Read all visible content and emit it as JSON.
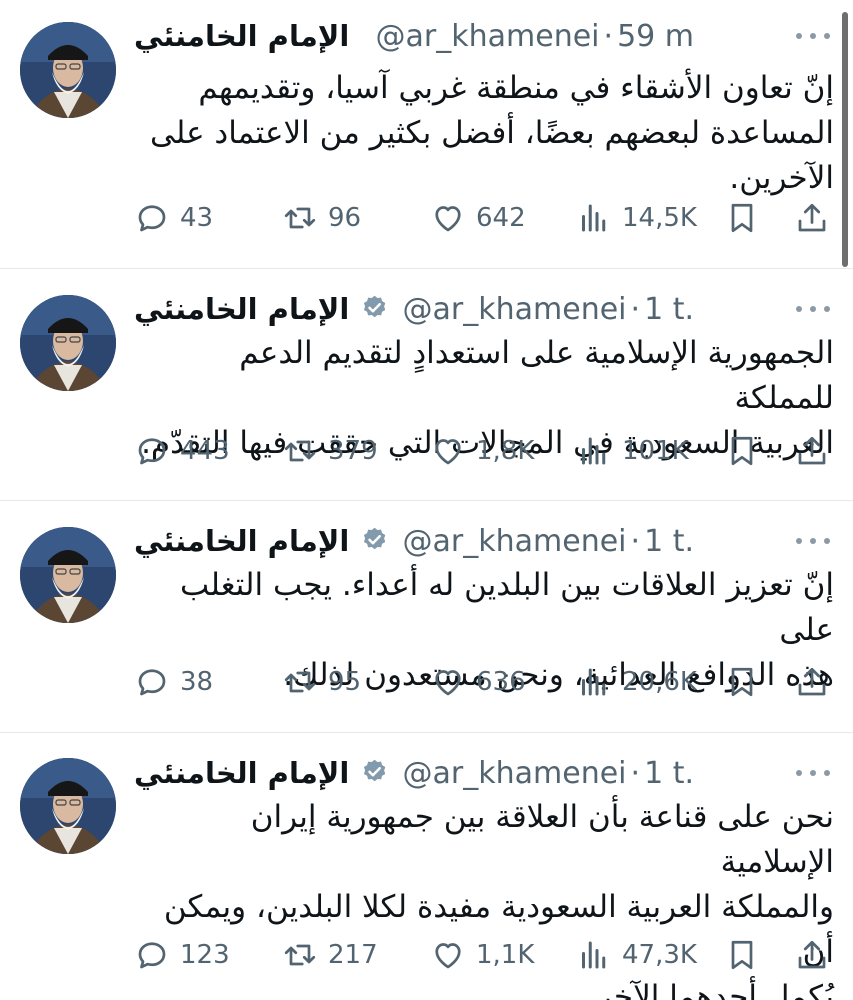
{
  "tweets": [
    {
      "name": "الإمام الخامنئي",
      "handle": "@ar_khamenei",
      "separator": "·",
      "time": "59 m",
      "lines": [
        "إنّ تعاون الأشقاء في منطقة غربي آسيا، وتقديمهم",
        "المساعدة لبعضهم بعضًا، أفضل بكثير من الاعتماد على",
        "الآخرين."
      ],
      "replies": "43",
      "reposts": "96",
      "likes": "642",
      "views": "14,5K"
    },
    {
      "name": "الإمام الخامنئي",
      "handle": "@ar_khamenei",
      "separator": "·",
      "time": "1 t.",
      "lines": [
        "الجمهورية الإسلامية على استعدادٍ لتقديم الدعم للمملكة",
        "العربية السعودية في المجالات التي حققت فيها التقدّم."
      ],
      "replies": "443",
      "reposts": "379",
      "likes": "1,8K",
      "views": "101K"
    },
    {
      "name": "الإمام الخامنئي",
      "handle": "@ar_khamenei",
      "separator": "·",
      "time": "1 t.",
      "lines": [
        "إنّ تعزيز العلاقات بين البلدين له أعداء. يجب التغلب على",
        "هذه الدوافع العدائية، ونحن مستعدون لذلك."
      ],
      "replies": "38",
      "reposts": "95",
      "likes": "636",
      "views": "20,6K"
    },
    {
      "name": "الإمام الخامنئي",
      "handle": "@ar_khamenei",
      "separator": "·",
      "time": "1 t.",
      "lines": [
        "نحن على قناعة بأن العلاقة بين جمهورية إيران الإسلامية",
        "والمملكة العربية السعودية مفيدة لكلا البلدين، ويمكن أن",
        "يُكمل أحدهما الآخر."
      ],
      "replies": "123",
      "reposts": "217",
      "likes": "1,1K",
      "views": "47,3K"
    }
  ],
  "icons": {
    "verified": "verified-badge-icon",
    "reply": "reply-icon",
    "repost": "repost-icon",
    "like": "heart-icon",
    "views": "views-icon",
    "bookmark": "bookmark-icon",
    "share": "share-icon",
    "more": "more-icon"
  },
  "colors": {
    "text": "#0f1419",
    "muted": "#536471",
    "verified": "#829aab",
    "divider": "#e6e9ec"
  }
}
